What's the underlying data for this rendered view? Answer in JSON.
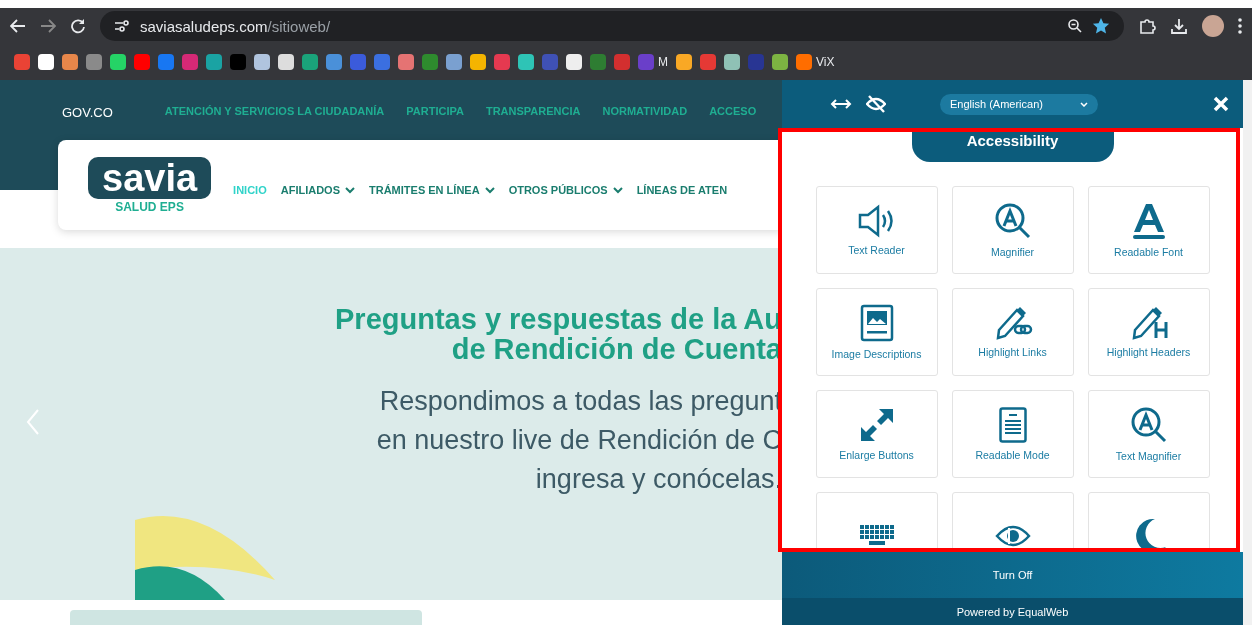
{
  "browser": {
    "url_domain": "saviasaludeps.com",
    "url_path": "/sitioweb/"
  },
  "bookmarks": [
    {
      "color": "#ea4335"
    },
    {
      "color": "#ffffff"
    },
    {
      "color": "#e8874a"
    },
    {
      "color": "#8a8a8a"
    },
    {
      "color": "#25d366"
    },
    {
      "color": "#ff0000"
    },
    {
      "color": "#1877f2"
    },
    {
      "color": "#d62976"
    },
    {
      "color": "#1aa3a3"
    },
    {
      "color": "#000000"
    },
    {
      "color": "#b0c4de"
    },
    {
      "color": "#dddddd"
    },
    {
      "color": "#1aa37a"
    },
    {
      "color": "#4a90d9"
    },
    {
      "color": "#3b5bdb"
    },
    {
      "color": "#3b6fe0"
    },
    {
      "color": "#e57373"
    },
    {
      "color": "#2e8b2e"
    },
    {
      "color": "#7aa0d0"
    },
    {
      "color": "#f4b400"
    },
    {
      "color": "#e53950"
    },
    {
      "color": "#2ec4b6"
    },
    {
      "color": "#3f51b5"
    },
    {
      "color": "#eeeeee"
    },
    {
      "color": "#2e7d32"
    },
    {
      "color": "#d32f2f"
    },
    {
      "color": "#6a3fc9",
      "label": "M"
    },
    {
      "color": "#f9a825"
    },
    {
      "color": "#e53935"
    },
    {
      "color": "#8fc1b5"
    },
    {
      "color": "#283593"
    },
    {
      "color": "#7cb342"
    },
    {
      "color": "#ff6d00",
      "label": "ViX"
    }
  ],
  "gov_bar": {
    "brand": "GOV.CO",
    "links": [
      "ATENCIÓN Y SERVICIOS LA CIUDADANÍA",
      "PARTICIPA",
      "TRANSPARENCIA",
      "NORMATIVIDAD",
      "ACCESO"
    ]
  },
  "logo": {
    "name": "savia",
    "subtitle": "SALUD EPS"
  },
  "nav": [
    {
      "label": "INICIO",
      "selected": true,
      "dropdown": false
    },
    {
      "label": "AFILIADOS",
      "selected": false,
      "dropdown": true
    },
    {
      "label": "TRÁMITES EN LÍNEA",
      "selected": false,
      "dropdown": true
    },
    {
      "label": "OTROS PÚBLICOS",
      "selected": false,
      "dropdown": true
    },
    {
      "label": "LÍNEAS DE ATEN",
      "selected": false,
      "dropdown": false
    }
  ],
  "hero": {
    "title_lines": [
      "Preguntas y respuestas de la Au",
      "de Rendición de Cuenta"
    ],
    "body_lines": [
      "Respondimos a todas las pregunt",
      "en nuestro live de Rendición de C",
      "ingresa y conócelas."
    ]
  },
  "panel": {
    "language": "English (American)",
    "tab": "Accessibility",
    "tools": [
      {
        "kind": "speaker",
        "label": "Text Reader"
      },
      {
        "kind": "magnifier",
        "label": "Magnifier"
      },
      {
        "kind": "font",
        "label": "Readable Font"
      },
      {
        "kind": "image",
        "label": "Image Descriptions"
      },
      {
        "kind": "links",
        "label": "Highlight Links"
      },
      {
        "kind": "headers",
        "label": "Highlight Headers"
      },
      {
        "kind": "enlarge",
        "label": "Enlarge Buttons"
      },
      {
        "kind": "document",
        "label": "Readable Mode"
      },
      {
        "kind": "magnifier",
        "label": "Text Magnifier"
      },
      {
        "kind": "keyboard"
      },
      {
        "kind": "eye"
      },
      {
        "kind": "moon"
      }
    ],
    "turn_off": "Turn Off",
    "powered_by": "Powered by EqualWeb"
  }
}
